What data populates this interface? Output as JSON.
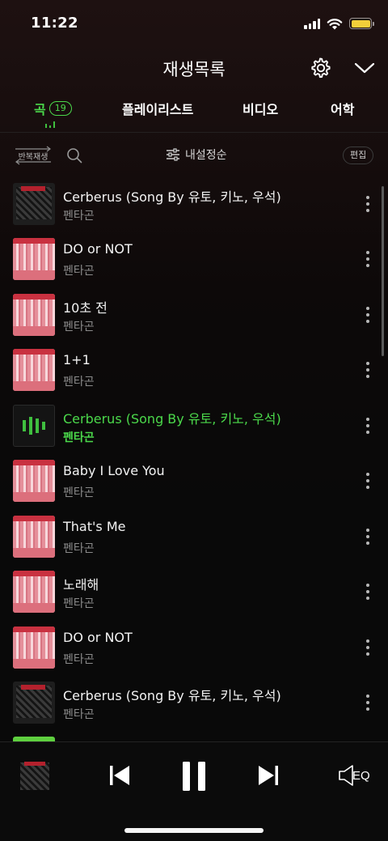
{
  "status_bar": {
    "time": "11:22",
    "icons": [
      "signal-icon",
      "wifi-icon",
      "battery-icon"
    ],
    "battery_color": "#f2cf3a"
  },
  "header": {
    "title": "재생목록",
    "icons": [
      "gear-icon",
      "chevron-down-icon"
    ]
  },
  "tabs": [
    {
      "label": "곡",
      "count": "19",
      "active": true
    },
    {
      "label": "플레이리스트",
      "active": false
    },
    {
      "label": "비디오",
      "active": false
    },
    {
      "label": "어학",
      "active": false
    }
  ],
  "toolbar": {
    "repeat_label": "반복재생",
    "sort_label": "내설정순",
    "edit_label": "편집"
  },
  "songs": [
    {
      "title": "Cerberus (Song By 유토, 키노, 우석)",
      "artist": "펜타곤",
      "art": "dark",
      "playing": false
    },
    {
      "title": "DO or NOT",
      "artist": "펜타곤",
      "art": "pink",
      "playing": false
    },
    {
      "title": "10초 전",
      "artist": "펜타곤",
      "art": "pink",
      "playing": false
    },
    {
      "title": "1+1",
      "artist": "펜타곤",
      "art": "pink",
      "playing": false
    },
    {
      "title": "Cerberus (Song By 유토, 키노, 우석)",
      "artist": "펜타곤",
      "art": "playing",
      "playing": true
    },
    {
      "title": "Baby I Love You",
      "artist": "펜타곤",
      "art": "pink",
      "playing": false
    },
    {
      "title": "That's Me",
      "artist": "펜타곤",
      "art": "pink",
      "playing": false
    },
    {
      "title": "노래해",
      "artist": "펜타곤",
      "art": "pink",
      "playing": false
    },
    {
      "title": "DO or NOT",
      "artist": "펜타곤",
      "art": "pink",
      "playing": false
    },
    {
      "title": "Cerberus (Song By 유토, 키노, 우석)",
      "artist": "펜타곤",
      "art": "dark",
      "playing": false
    }
  ],
  "player": {
    "eq_label": "EQ",
    "state": "playing",
    "icons": [
      "previous-icon",
      "pause-icon",
      "next-icon",
      "speaker-icon"
    ]
  },
  "colors": {
    "accent": "#4bd94b",
    "background": "#090909"
  }
}
